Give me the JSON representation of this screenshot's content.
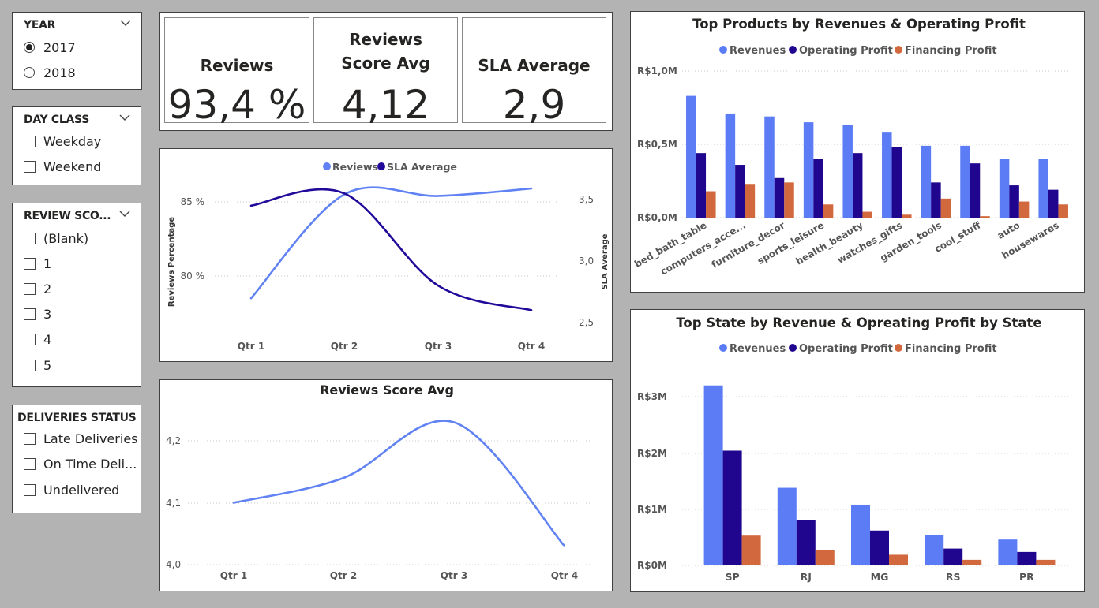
{
  "slicers": {
    "year": {
      "title": "YEAR",
      "options": [
        {
          "label": "2017",
          "selected": true
        },
        {
          "label": "2018",
          "selected": false
        }
      ]
    },
    "day_class": {
      "title": "DAY CLASS",
      "options": [
        "Weekday",
        "Weekend"
      ]
    },
    "review_score": {
      "title": "REVIEW SCO...",
      "options": [
        "(Blank)",
        "1",
        "2",
        "3",
        "4",
        "5"
      ]
    },
    "deliveries_status": {
      "title": "DELIVERIES STATUS",
      "options": [
        "Late Deliveries",
        "On Time Deli...",
        "Undelivered"
      ]
    }
  },
  "cards": [
    {
      "label": "Reviews",
      "value": "93,4 %"
    },
    {
      "label": "Reviews Score Avg",
      "value": "4,12"
    },
    {
      "label": "SLA Average",
      "value": "2,9"
    }
  ],
  "colors": {
    "revenues": "#5b7cf5",
    "operating_profit": "#20068f",
    "financing_profit": "#d2693e",
    "reviews_line": "#6082f2",
    "sla_line": "#23099a"
  },
  "chart_data": [
    {
      "type": "line",
      "title": "",
      "legend": [
        "Reviews",
        "SLA Average"
      ],
      "legend_position": "top-center",
      "x": [
        "Qtr 1",
        "Qtr 2",
        "Qtr 3",
        "Qtr 4"
      ],
      "series": [
        {
          "name": "Reviews",
          "axis": "left",
          "values": [
            78.5,
            85.5,
            85.4,
            85.9
          ]
        },
        {
          "name": "SLA Average",
          "axis": "right",
          "values": [
            3.45,
            3.55,
            2.8,
            2.6
          ]
        }
      ],
      "ylabel": "Reviews Percentage",
      "y2label": "SLA Average",
      "y_ticks": [
        "80 %",
        "85 %"
      ],
      "y2_ticks": [
        "2,5",
        "3,0",
        "3,5"
      ],
      "ylim": [
        76.5,
        88.5
      ],
      "y2lim": [
        2.45,
        3.75
      ],
      "grid": true
    },
    {
      "type": "line",
      "title": "Reviews Score Avg",
      "x": [
        "Qtr 1",
        "Qtr 2",
        "Qtr 3",
        "Qtr 4"
      ],
      "series": [
        {
          "name": "Reviews Score Avg",
          "values": [
            4.1,
            4.14,
            4.23,
            4.03
          ]
        }
      ],
      "y_ticks": [
        "4,0",
        "4,1",
        "4,2"
      ],
      "ylim": [
        4.0,
        4.26
      ],
      "grid": true
    },
    {
      "type": "bar",
      "title": "Top Products by Revenues & Operating Profit",
      "legend": [
        "Revenues",
        "Operating Profit",
        "Financing Profit"
      ],
      "legend_position": "top-center",
      "categories": [
        "bed_bath_table",
        "computers_acce...",
        "furniture_decor",
        "sports_leisure",
        "health_beauty",
        "watches_gifts",
        "garden_tools",
        "cool_stuff",
        "auto",
        "housewares"
      ],
      "series": [
        {
          "name": "Revenues",
          "values": [
            0.83,
            0.71,
            0.69,
            0.65,
            0.63,
            0.58,
            0.49,
            0.49,
            0.4,
            0.4
          ]
        },
        {
          "name": "Operating Profit",
          "values": [
            0.44,
            0.36,
            0.27,
            0.4,
            0.44,
            0.48,
            0.24,
            0.37,
            0.22,
            0.19
          ]
        },
        {
          "name": "Financing Profit",
          "values": [
            0.18,
            0.23,
            0.24,
            0.09,
            0.04,
            0.02,
            0.13,
            0.01,
            0.11,
            0.09
          ]
        }
      ],
      "y_ticks": [
        "R$0,0M",
        "R$0,5M",
        "R$1,0M"
      ],
      "ylim": [
        0,
        1.0
      ],
      "grid": true
    },
    {
      "type": "bar",
      "title": "Top State by Revenue & Opreating Profit by State",
      "legend": [
        "Revenues",
        "Operating Profit",
        "Financing Profit"
      ],
      "legend_position": "top-center",
      "categories": [
        "SP",
        "RJ",
        "MG",
        "RS",
        "PR"
      ],
      "series": [
        {
          "name": "Revenues",
          "values": [
            3.2,
            1.38,
            1.08,
            0.54,
            0.46
          ]
        },
        {
          "name": "Operating Profit",
          "values": [
            2.04,
            0.8,
            0.62,
            0.3,
            0.24
          ]
        },
        {
          "name": "Financing Profit",
          "values": [
            0.53,
            0.27,
            0.19,
            0.1,
            0.1
          ]
        }
      ],
      "y_ticks": [
        "R$0M",
        "R$1M",
        "R$2M",
        "R$3M"
      ],
      "ylim": [
        0,
        3.0
      ],
      "grid": true
    }
  ]
}
